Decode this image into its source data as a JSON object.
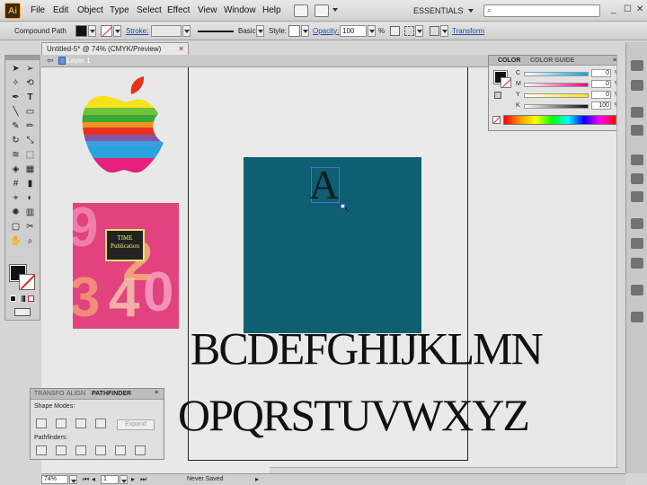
{
  "app": {
    "logo_text": "Ai",
    "workspace": "ESSENTIALS"
  },
  "menu": [
    "File",
    "Edit",
    "Object",
    "Type",
    "Select",
    "Effect",
    "View",
    "Window",
    "Help"
  ],
  "window_buttons": [
    "_",
    "☐",
    "✕"
  ],
  "control_bar": {
    "selection_label": "Compound Path",
    "stroke_label": "Stroke:",
    "stroke_style": "Basic",
    "style_label": "Style:",
    "opacity_label": "Opacity:",
    "opacity_value": "100",
    "opacity_unit": "%",
    "transform_link": "Transform"
  },
  "document": {
    "tab_title": "Untitled-5* @ 74% (CMYK/Preview)",
    "tab_close": "✕",
    "layer_name": "Layer 1",
    "zoom": "74%",
    "page": "1",
    "status": "Never Saved"
  },
  "artwork": {
    "letter_a": "A",
    "alphabet_line1": "BCDEFGHIJKLMN",
    "alphabet_line2": "OPQRSTUVWXYZ",
    "book_title_line1": "TIME",
    "book_title_line2": "Publication",
    "teal_color": "#0e5f72"
  },
  "color_panel": {
    "tabs": [
      "COLOR",
      "COLOR GUIDE"
    ],
    "sliders": [
      {
        "label": "C",
        "value": "0",
        "unit": "%"
      },
      {
        "label": "M",
        "value": "0",
        "unit": "%"
      },
      {
        "label": "Y",
        "value": "0",
        "unit": "%"
      },
      {
        "label": "K",
        "value": "100",
        "unit": "%"
      }
    ]
  },
  "pathfinder_panel": {
    "tabs": [
      "TRANSFO",
      "ALIGN",
      "PATHFINDER"
    ],
    "shape_modes_label": "Shape Modes:",
    "pathfinders_label": "Pathfinders:",
    "expand_label": "Expand"
  }
}
